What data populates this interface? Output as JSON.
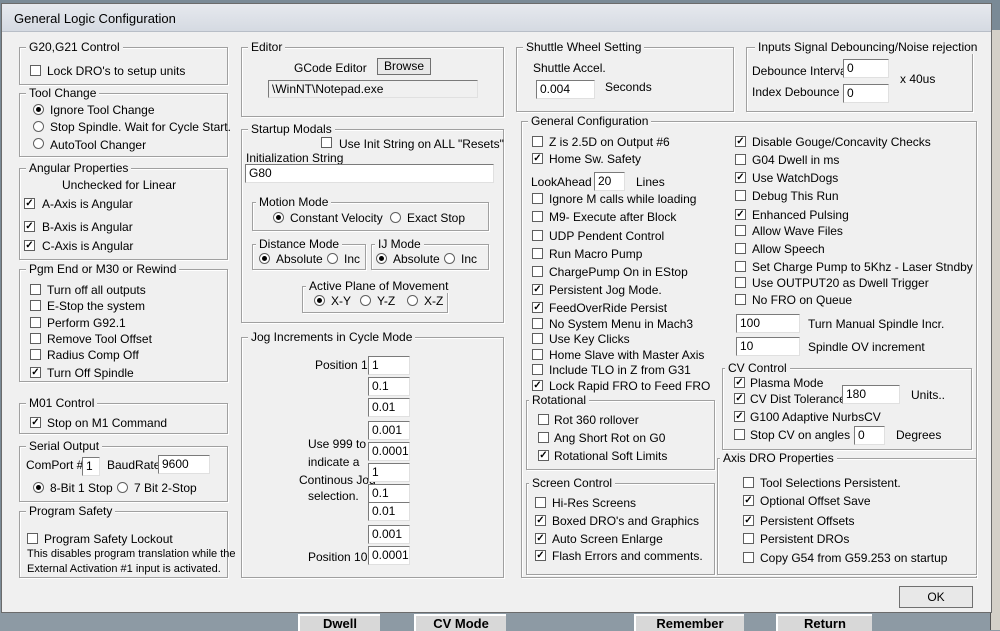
{
  "window_title": "General Logic Configuration",
  "background_buttons": [
    "Dwell",
    "CV Mode",
    "Remember",
    "Return"
  ],
  "g20g21": {
    "title": "G20,G21 Control",
    "lock_dros": {
      "label": "Lock DRO's to setup units",
      "checked": false
    }
  },
  "tool_change": {
    "title": "Tool Change",
    "options": [
      "Ignore Tool Change",
      "Stop Spindle. Wait for Cycle Start.",
      "AutoTool Changer"
    ],
    "selected": 0
  },
  "angular": {
    "title": "Angular Properties",
    "subtitle": "Unchecked for Linear",
    "items": [
      {
        "label": "A-Axis is Angular",
        "checked": true
      },
      {
        "label": "B-Axis is Angular",
        "checked": true
      },
      {
        "label": "C-Axis is Angular",
        "checked": true
      }
    ]
  },
  "pgm_end": {
    "title": "Pgm End or M30 or Rewind",
    "items": [
      {
        "label": "Turn off all outputs",
        "checked": false
      },
      {
        "label": "E-Stop the system",
        "checked": false
      },
      {
        "label": "Perform G92.1",
        "checked": false
      },
      {
        "label": "Remove Tool Offset",
        "checked": false
      },
      {
        "label": "Radius Comp Off",
        "checked": false
      },
      {
        "label": "Turn Off Spindle",
        "checked": true
      }
    ]
  },
  "m01": {
    "title": "M01 Control",
    "stop_m1": {
      "label": "Stop on M1 Command",
      "checked": true
    }
  },
  "serial": {
    "title": "Serial Output",
    "comport_label": "ComPort #",
    "comport": "1",
    "baud_label": "BaudRate",
    "baud": "9600",
    "options": [
      "8-Bit 1 Stop",
      "7 Bit 2-Stop"
    ],
    "selected": 0
  },
  "safety": {
    "title": "Program Safety",
    "lockout": {
      "label": "Program Safety Lockout",
      "checked": false
    },
    "note1": "This disables program translation while the",
    "note2": "External Activation #1 input is activated."
  },
  "editor": {
    "title": "Editor",
    "label": "GCode Editor",
    "browse": "Browse",
    "path": "\\WinNT\\Notepad.exe"
  },
  "startup": {
    "title": "Startup Modals",
    "use_init": {
      "label": "Use Init String on ALL  \"Resets\"",
      "checked": false
    },
    "init_label": "Initialization String",
    "init_value": "G80",
    "motion": {
      "title": "Motion Mode",
      "options": [
        "Constant Velocity",
        "Exact Stop"
      ],
      "selected": 0
    },
    "distance": {
      "title": "Distance Mode",
      "options": [
        "Absolute",
        "Inc"
      ],
      "selected": 0
    },
    "ij": {
      "title": "IJ Mode",
      "options": [
        "Absolute",
        "Inc"
      ],
      "selected": 0
    },
    "plane": {
      "title": "Active Plane of Movement",
      "options": [
        "X-Y",
        "Y-Z",
        "X-Z"
      ],
      "selected": 0
    }
  },
  "jog": {
    "title": "Jog Increments in Cycle Mode",
    "pos1_label": "Position 1",
    "pos10_label": "Position 10",
    "note": [
      "Use 999 to",
      "indicate a",
      "Continous Jog",
      "selection."
    ],
    "values": [
      "1",
      "0.1",
      "0.01",
      "0.001",
      "0.0001",
      "1",
      "0.1",
      "0.01",
      "0.001",
      "0.0001"
    ]
  },
  "shuttle": {
    "title": "Shuttle Wheel Setting",
    "accel_label": "Shuttle Accel.",
    "accel": "0.004",
    "unit": "Seconds"
  },
  "debounce": {
    "title": "Inputs Signal Debouncing/Noise rejection",
    "interval_label": "Debounce Interval",
    "interval": "0",
    "unit": "x 40us",
    "index_label": "Index Debounce",
    "index": "0"
  },
  "general": {
    "title": "General Configuration",
    "left": [
      {
        "label": "Z is 2.5D on Output #6",
        "checked": false
      },
      {
        "label": "Home Sw. Safety",
        "checked": true
      }
    ],
    "lookahead_label": "LookAhead",
    "lookahead": "20",
    "lookahead_unit": "Lines",
    "left2": [
      {
        "label": "Ignore M calls while loading",
        "checked": false
      },
      {
        "label": "M9- Execute after Block",
        "checked": false
      },
      {
        "label": "UDP Pendent Control",
        "checked": false
      },
      {
        "label": "Run Macro Pump",
        "checked": false
      },
      {
        "label": "ChargePump On in EStop",
        "checked": false
      },
      {
        "label": "Persistent Jog Mode.",
        "checked": true
      },
      {
        "label": "FeedOverRide Persist",
        "checked": true
      },
      {
        "label": "No System Menu in Mach3",
        "checked": false
      },
      {
        "label": "Use Key Clicks",
        "checked": false
      },
      {
        "label": "Home Slave with Master Axis",
        "checked": false
      },
      {
        "label": "Include TLO in Z from G31",
        "checked": false
      },
      {
        "label": "Lock Rapid FRO to Feed FRO",
        "checked": true
      }
    ],
    "right": [
      {
        "label": "Disable Gouge/Concavity Checks",
        "checked": true
      },
      {
        "label": "G04 Dwell in ms",
        "checked": false
      },
      {
        "label": "Use WatchDogs",
        "checked": true
      },
      {
        "label": "Debug This Run",
        "checked": false
      },
      {
        "label": "Enhanced Pulsing",
        "checked": true
      },
      {
        "label": "Allow Wave Files",
        "checked": false
      },
      {
        "label": "Allow Speech",
        "checked": false
      },
      {
        "label": "Set Charge Pump to 5Khz  - Laser Stndby",
        "checked": false
      },
      {
        "label": "Use OUTPUT20 as Dwell Trigger",
        "checked": false
      },
      {
        "label": "No FRO on Queue",
        "checked": false
      }
    ],
    "spindle_incr": "100",
    "spindle_incr_label": "Turn Manual Spindle Incr.",
    "spindle_ov": "10",
    "spindle_ov_label": "Spindle OV increment"
  },
  "rotational": {
    "title": "Rotational",
    "items": [
      {
        "label": "Rot 360 rollover",
        "checked": false
      },
      {
        "label": "Ang Short Rot on G0",
        "checked": false
      },
      {
        "label": "Rotational Soft Limits",
        "checked": true
      }
    ]
  },
  "screen": {
    "title": "Screen Control",
    "items": [
      {
        "label": "Hi-Res Screens",
        "checked": false
      },
      {
        "label": "Boxed DRO's and Graphics",
        "checked": true
      },
      {
        "label": "Auto Screen Enlarge",
        "checked": true
      },
      {
        "label": "Flash Errors and comments.",
        "checked": true
      }
    ]
  },
  "cv": {
    "title": "CV Control",
    "plasma": {
      "label": "Plasma Mode",
      "checked": true
    },
    "dist": {
      "label": "CV Dist Tolerance",
      "checked": true
    },
    "dist_value": "180",
    "dist_unit": "Units..",
    "g100": {
      "label": "G100 Adaptive NurbsCV",
      "checked": true
    },
    "stop": {
      "label": "Stop CV on angles >",
      "checked": false
    },
    "stop_value": "0",
    "stop_unit": "Degrees"
  },
  "axis_dro": {
    "title": "Axis DRO Properties",
    "items": [
      {
        "label": "Tool Selections Persistent.",
        "checked": false
      },
      {
        "label": "Optional Offset Save",
        "checked": true
      },
      {
        "label": "Persistent Offsets",
        "checked": true
      },
      {
        "label": "Persistent DROs",
        "checked": false
      },
      {
        "label": "Copy G54 from G59.253 on startup",
        "checked": false
      }
    ]
  },
  "ok": "OK"
}
